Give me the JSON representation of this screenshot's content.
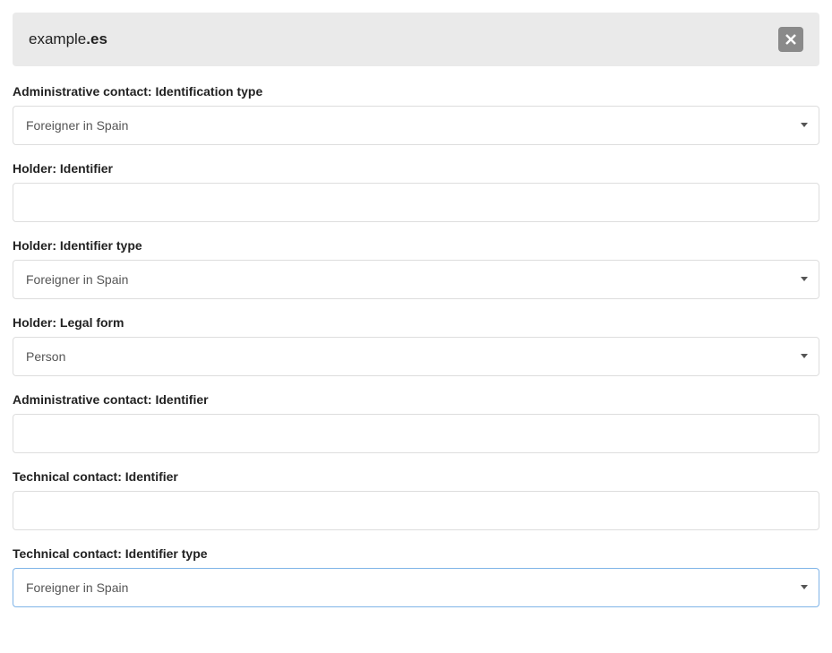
{
  "header": {
    "domain_prefix": "example",
    "domain_suffix": ".es"
  },
  "fields": {
    "admin_id_type": {
      "label": "Administrative contact: Identification type",
      "value": "Foreigner in Spain"
    },
    "holder_identifier": {
      "label": "Holder: Identifier",
      "value": ""
    },
    "holder_id_type": {
      "label": "Holder: Identifier type",
      "value": "Foreigner in Spain"
    },
    "holder_legal_form": {
      "label": "Holder: Legal form",
      "value": "Person"
    },
    "admin_identifier": {
      "label": "Administrative contact: Identifier",
      "value": ""
    },
    "tech_identifier": {
      "label": "Technical contact: Identifier",
      "value": ""
    },
    "tech_id_type": {
      "label": "Technical contact: Identifier type",
      "value": "Foreigner in Spain"
    }
  }
}
